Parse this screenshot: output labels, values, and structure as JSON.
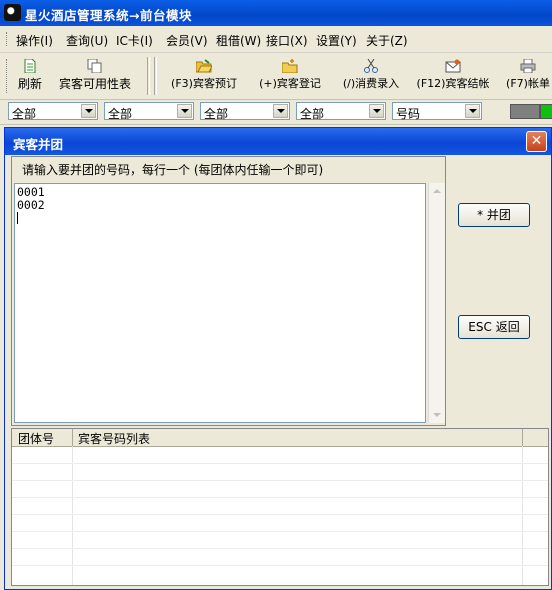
{
  "window": {
    "title": "星火酒店管理系统→前台模块"
  },
  "menu": [
    "操作(I)",
    "查询(U)",
    "IC卡(I)",
    "会员(V)",
    "租借(W)",
    "接口(X)",
    "设置(Y)",
    "关于(Z)"
  ],
  "toolbar": {
    "refresh": "刷新",
    "availability": "宾客可用性表",
    "reservation": "(F3)宾客预订",
    "checkin": "(+)宾客登记",
    "consume": "(/)消费录入",
    "checkout": "(F12)宾客结帐",
    "bill": "(F7)帐单"
  },
  "filters": {
    "f1": "全部",
    "f2": "全部",
    "f3": "全部",
    "f4": "全部",
    "f5": "号码"
  },
  "dialog": {
    "title": "宾客并团",
    "hint": "请输入要并团的号码，每行一个 (每团体内任输一个即可)",
    "lines": [
      "0001",
      "0002"
    ],
    "merge_button": "* 并团",
    "back_button": "ESC 返回",
    "columns": [
      "团体号",
      "宾客号码列表"
    ]
  },
  "icons": {
    "refresh": "document-icon",
    "availability": "copy-icon",
    "reservation": "folder-open-icon",
    "checkin": "folder-new-icon",
    "consume": "scissors-icon",
    "checkout": "envelope-icon",
    "bill": "printer-icon"
  }
}
